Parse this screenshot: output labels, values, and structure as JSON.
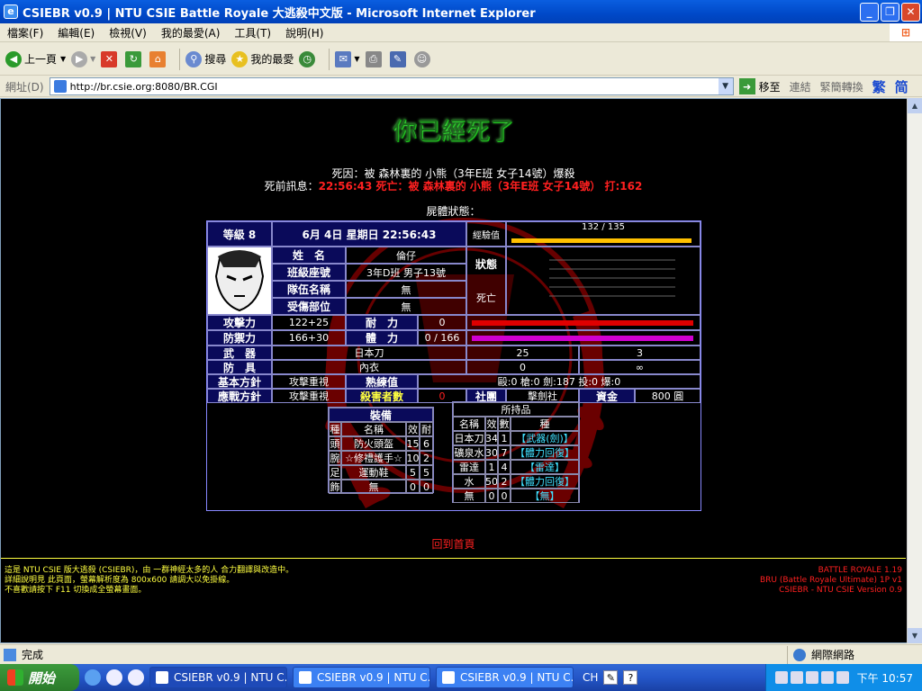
{
  "window": {
    "title": "CSIEBR v0.9 | NTU CSIE Battle Royale 大逃殺中文版 - Microsoft Internet Explorer"
  },
  "menu": [
    "檔案(F)",
    "編輯(E)",
    "檢視(V)",
    "我的最愛(A)",
    "工具(T)",
    "說明(H)"
  ],
  "toolbar": {
    "back": "上一頁",
    "search": "搜尋",
    "favorites": "我的最愛"
  },
  "address": {
    "label": "網址(D)",
    "url": "http://br.csie.org:8080/BR.CGI",
    "go": "移至",
    "links": "連結",
    "convert": "緊簡轉換",
    "trad": "繁",
    "simp": "简"
  },
  "page": {
    "death_title": "你已經死了",
    "cause": "死因：被 森林裏的 小熊（3年E班 女子14號）爆殺",
    "last_label": "死前訊息：",
    "last_msg": "22:56:43 死亡：被 森林裏的 小熊（3年E班 女子14號） 打:162",
    "body_state": "屍體狀態：",
    "home_link": "回到首頁"
  },
  "status": {
    "level": "等級 8",
    "date": "6月 4日 星期日 22:56:43",
    "exp_label": "經驗值",
    "exp_value": "132 / 135",
    "exp_fraction": 0.978,
    "name_label": "姓　名",
    "name": "倫仔",
    "class_label": "班級座號",
    "class": "3年D班 男子13號",
    "team_label": "隊伍名稱",
    "team": "無",
    "injury_label": "受傷部位",
    "injury": "無",
    "state_label": "狀態",
    "state": "死亡",
    "atk_label": "攻擊力",
    "atk": "122+25",
    "hp_label": "耐　力",
    "hp": "0",
    "def_label": "防禦力",
    "def": "166+30",
    "sp_label": "體　力",
    "sp": "0 / 166",
    "weapon_label": "武　器",
    "weapon": "日本刀",
    "weapon_eff": "25",
    "weapon_dur": "3",
    "armor_label": "防　具",
    "armor": "內衣",
    "armor_eff": "0",
    "armor_dur": "∞",
    "policy_label": "基本方針",
    "policy": "攻擊重視",
    "skill_label": "熟練值",
    "skill": "毆:0 槍:0 劍:187 投:0 爆:0",
    "battle_label": "應戰方針",
    "battle": "攻擊重視",
    "kills_label": "殺害者數",
    "kills": "0",
    "club_label": "社團",
    "club": "擊劍社",
    "money_label": "資金",
    "money": "800 圓"
  },
  "equipment": {
    "title": "裝備",
    "headers": [
      "種",
      "名稱",
      "效",
      "耐"
    ],
    "rows": [
      [
        "頭",
        "防火頭盔",
        "15",
        "6"
      ],
      [
        "腕",
        "☆修禮護手☆",
        "10",
        "2"
      ],
      [
        "足",
        "運動鞋",
        "5",
        "5"
      ],
      [
        "飾",
        "無",
        "0",
        "0"
      ]
    ]
  },
  "items": {
    "title": "所持品",
    "headers": [
      "名稱",
      "效",
      "數",
      "種"
    ],
    "rows": [
      [
        "日本刀",
        "34",
        "1",
        "【武器(劍)】"
      ],
      [
        "礦泉水",
        "30",
        "7",
        "【體力回復】"
      ],
      [
        "雷達",
        "1",
        "4",
        "【雷達】"
      ],
      [
        "水",
        "50",
        "2",
        "【體力回復】"
      ],
      [
        "無",
        "0",
        "0",
        "【無】"
      ]
    ]
  },
  "footer": {
    "left": [
      "這是 NTU CSIE 版大逃殺 (CSIEBR)，由 一群神經太多的人 合力翻譯與改造中。",
      "詳細說明見 此頁面，螢幕解析度為 800x600 請調大以免掛線。",
      "不喜歡請按下 F11 切換成全螢幕畫面。"
    ],
    "right": [
      "BATTLE ROYALE 1.19",
      "BRU (Battle Royale Ultimate) 1P v1",
      "CSIEBR - NTU CSIE Version 0.9"
    ]
  },
  "statusbar": {
    "text": "完成",
    "zone": "網際網路"
  },
  "taskbar": {
    "start": "開始",
    "tasks": [
      "CSIEBR v0.9 | NTU C...",
      "CSIEBR v0.9 | NTU C...",
      "CSIEBR v0.9 | NTU C..."
    ],
    "lang": "CH",
    "clock": "下午 10:57"
  },
  "colors": {
    "bg": "#000000",
    "accent_red": "#ff2020",
    "accent_yellow": "#ffff40",
    "cyan": "#40e0ff",
    "hp_bar": "#e00000",
    "sp_bar": "#d000d0",
    "exp_bar": "#ffc000"
  }
}
